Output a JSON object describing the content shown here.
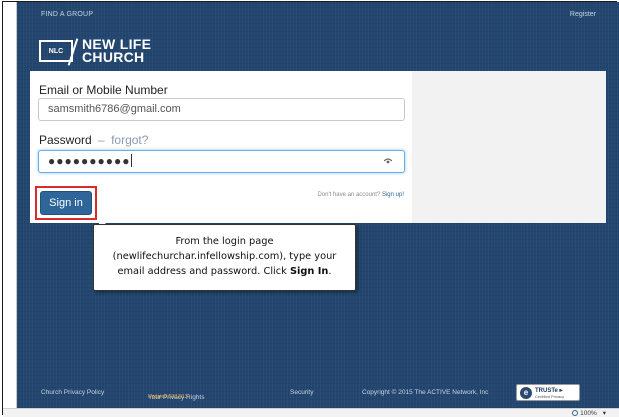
{
  "header": {
    "find_group": "FIND A GROUP",
    "register": "Register"
  },
  "logo": {
    "badge": "NLC",
    "line1": "NEW LIFE",
    "line2": "CHURCH"
  },
  "form": {
    "email_label": "Email or Mobile Number",
    "email_value": "samsmith6786@gmail.com",
    "password_label": "Password",
    "forgot_separator": "–",
    "forgot_link": "forgot?",
    "password_mask": "●●●●●●●●●●",
    "signin_label": "Sign in",
    "no_account_text": "Don't have an account?",
    "signup_link": "Sign up!"
  },
  "callout": {
    "line1": "From the login page",
    "line2": "(newlifechurchar.infellowship.com), type your",
    "line3_pre": "email address and password.  Click ",
    "line3_bold": "Sign In",
    "line3_post": "."
  },
  "footer": {
    "privacy_policy": "Church Privacy Policy",
    "privacy_rights": "Your Privacy Rights",
    "updated": "Updated 12/12/13",
    "security": "Security",
    "copyright": "Copyright © 2015 The ACTIVE Network, Inc",
    "truste_title": "TRUSTe ▸",
    "truste_sub": "Certified Privacy"
  },
  "statusbar": {
    "zoom": "100%",
    "zoom_arrow": "▾"
  },
  "colors": {
    "background": "#22466f",
    "signin_button": "#2f6699",
    "highlight_box": "#d92b2b",
    "updated_text": "#e8a23a"
  }
}
